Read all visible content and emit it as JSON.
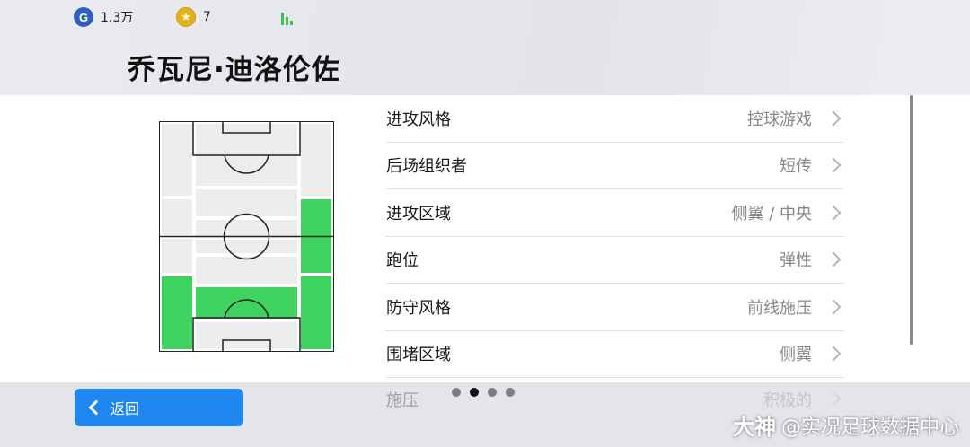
{
  "status": {
    "gp_amount": "1.3万",
    "coin_amount": "7"
  },
  "player_name": "乔瓦尼·迪洛伦佐",
  "colors": {
    "zone_active": "#3ed35e",
    "zone_inactive": "#ececec",
    "accent": "#1f86f0"
  },
  "field": {
    "active_zones": [
      "left-wing-attack",
      "left-back",
      "right-back",
      "defensive-midfield"
    ]
  },
  "settings": [
    {
      "label": "进攻风格",
      "value": "控球游戏"
    },
    {
      "label": "后场组织者",
      "value": "短传"
    },
    {
      "label": "进攻区域",
      "value": "侧翼 / 中央"
    },
    {
      "label": "跑位",
      "value": "弹性"
    },
    {
      "label": "防守风格",
      "value": "前线施压"
    },
    {
      "label": "围堵区域",
      "value": "侧翼"
    },
    {
      "label": "施压",
      "value": "积极的"
    }
  ],
  "pagination": {
    "count": 4,
    "active": 1
  },
  "footer": {
    "back_label": "返回",
    "watermark_logo": "大神",
    "watermark_text": "@实况足球数据中心"
  }
}
